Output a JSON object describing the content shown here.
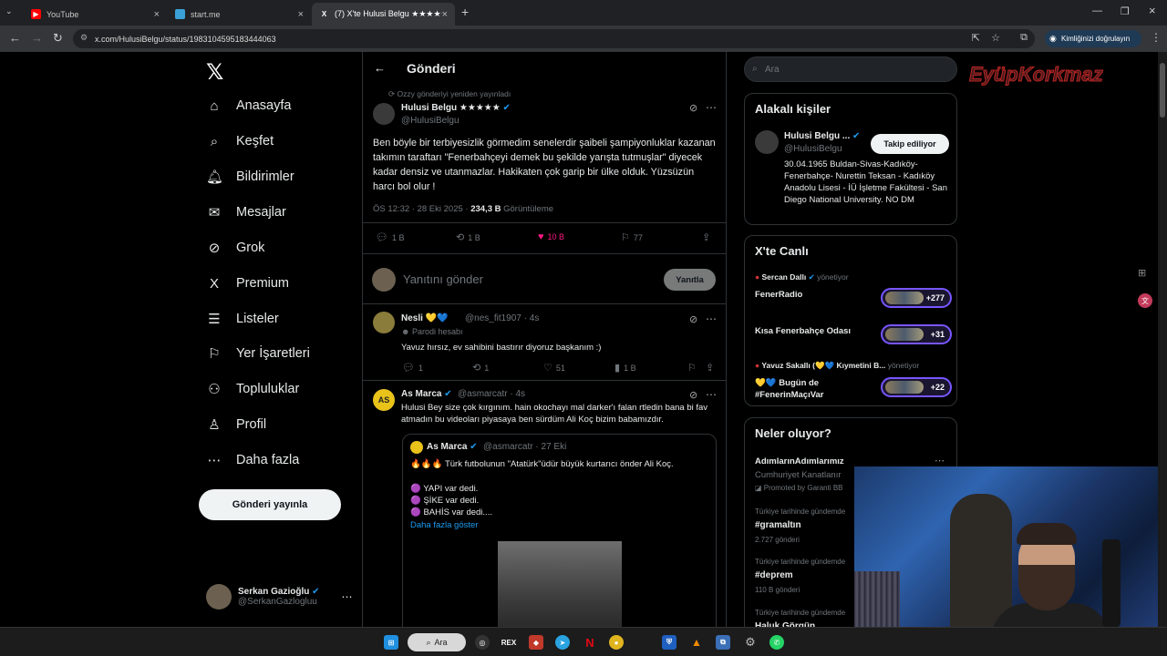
{
  "browser": {
    "tabs": [
      {
        "label": "YouTube",
        "color": "#ff0000"
      },
      {
        "label": "start.me",
        "color": "#3aa0d8"
      },
      {
        "label": "(7) X'te Hulusi Belgu ★★★★★",
        "color": "#ffffff",
        "active": true
      }
    ],
    "url": "x.com/HulusiBelgu/status/1983104595183444063",
    "verify_label": "Kimliğinizi doğrulayın"
  },
  "nav": {
    "items": [
      {
        "key": "home",
        "label": "Anasayfa",
        "icon": "⌂"
      },
      {
        "key": "explore",
        "label": "Keşfet",
        "icon": "⌕"
      },
      {
        "key": "notifications",
        "label": "Bildirimler",
        "icon": "🔔︎"
      },
      {
        "key": "messages",
        "label": "Mesajlar",
        "icon": "✉"
      },
      {
        "key": "grok",
        "label": "Grok",
        "icon": "⊘"
      },
      {
        "key": "premium",
        "label": "Premium",
        "icon": "X"
      },
      {
        "key": "lists",
        "label": "Listeler",
        "icon": "☰"
      },
      {
        "key": "bookmarks",
        "label": "Yer İşaretleri",
        "icon": "⚐"
      },
      {
        "key": "communities",
        "label": "Topluluklar",
        "icon": "⚇"
      },
      {
        "key": "profile",
        "label": "Profil",
        "icon": "♙"
      },
      {
        "key": "more",
        "label": "Daha fazla",
        "icon": "⋯"
      }
    ],
    "post_button": "Gönderi yayınla",
    "account": {
      "name": "Serkan Gazioğlu",
      "handle": "@SerkanGazlogluu"
    }
  },
  "main": {
    "title": "Gönderi",
    "repost_note": "Ozzy gönderiyi yeniden yayınladı",
    "tweet": {
      "name": "Hulusi Belgu ★★★★★",
      "handle": "@HulusiBelgu",
      "text": "Ben böyle bir terbiyesizlik görmedim senelerdir şaibeli şampiyonluklar kazanan takımın taraftarı \"Fenerbahçeyi demek bu şekilde yarışta tutmuşlar\" diyecek kadar densiz ve utanmazlar. Hakikaten çok garip bir ülke olduk. Yüzsüzün harcı bol olur !",
      "time": "ÖS 12:32 · 28 Eki 2025 · ",
      "views": "234,3 B",
      "views_label": " Görüntüleme",
      "replies": "1 B",
      "reposts": "1 B",
      "likes": "10 B",
      "bookmarks": "77"
    },
    "reply_placeholder": "Yanıtını gönder",
    "reply_button": "Yanıtla",
    "replies": [
      {
        "name": "Nesli 💛💙",
        "handle": "@nes_fit1907 · 4s",
        "parody": "Parodi hesabı",
        "text": "Yavuz hırsız, ev sahibini bastırır diyoruz başkanım :)",
        "replies": "1",
        "reposts": "1",
        "likes": "51",
        "views": "1 B"
      },
      {
        "name": "As Marca",
        "handle": "@asmarcatr · 4s",
        "text": "Hulusi Bey size çok kırgınım. hain okochayı mal darker'ı falan rtledin bana bi fav atmadın bu videoları piyasaya ben sürdüm Ali Koç bizim babamızdır.",
        "quote": {
          "name": "As Marca",
          "handle": "@asmarcatr · 27 Eki",
          "line1": "🔥🔥🔥 Türk futbolunun \"Atatürk\"üdür büyük kurtarıcı önder Ali Koç.",
          "line2": "🟣 YAPI var dedi.",
          "line3": "🟣 ŞİKE var dedi.",
          "line4": "🟣 BAHİS var dedi....",
          "more": "Daha fazla göster"
        }
      }
    ]
  },
  "right": {
    "search_placeholder": "Ara",
    "brand": "EyüpKorkmaz",
    "related": {
      "title": "Alakalı kişiler",
      "name": "Hulusi Belgu ...",
      "handle": "@HulusiBelgu",
      "follow": "Takip ediliyor",
      "bio": "30.04.1965 Buldan-Sivas-Kadıköy-Fenerbahçe- Nurettin Teksan - Kadıköy Anadolu Lisesi - İÜ İşletme Fakültesi - San Diego National University. NO DM"
    },
    "live": {
      "title": "X'te Canlı",
      "items": [
        {
          "host": "Sercan Dallı",
          "role": "yönetiyor",
          "name": "FenerRadio",
          "count": "+277"
        },
        {
          "host": "",
          "role": "",
          "name": "Kısa Fenerbahçe Odası",
          "count": "+31"
        },
        {
          "host": "Yavuz Sakallı (💛💙 Kıymetini B...",
          "role": "yönetiyor",
          "name": "💛💙 Bugün de #FenerinMaçıVar",
          "count": "+22"
        }
      ]
    },
    "trends": {
      "title": "Neler oluyor?",
      "items": [
        {
          "top": "",
          "tag": "AdımlarınAdımlarımız",
          "sub": "Cumhuriyet Kanatlanır"
        },
        {
          "top": "",
          "tag": "",
          "sub": "Promoted by Garanti BB"
        },
        {
          "top": "Türkiye tarihinde gündemde",
          "tag": "#gramaltın",
          "sub": "2.727 gönderi"
        },
        {
          "top": "Türkiye tarihinde gündemde",
          "tag": "#deprem",
          "sub": "110 B gönderi"
        },
        {
          "top": "Türkiye tarihinde gündemde",
          "tag": "Haluk Görgün",
          "sub": ""
        }
      ]
    }
  },
  "taskbar": {
    "search": "Ara"
  }
}
